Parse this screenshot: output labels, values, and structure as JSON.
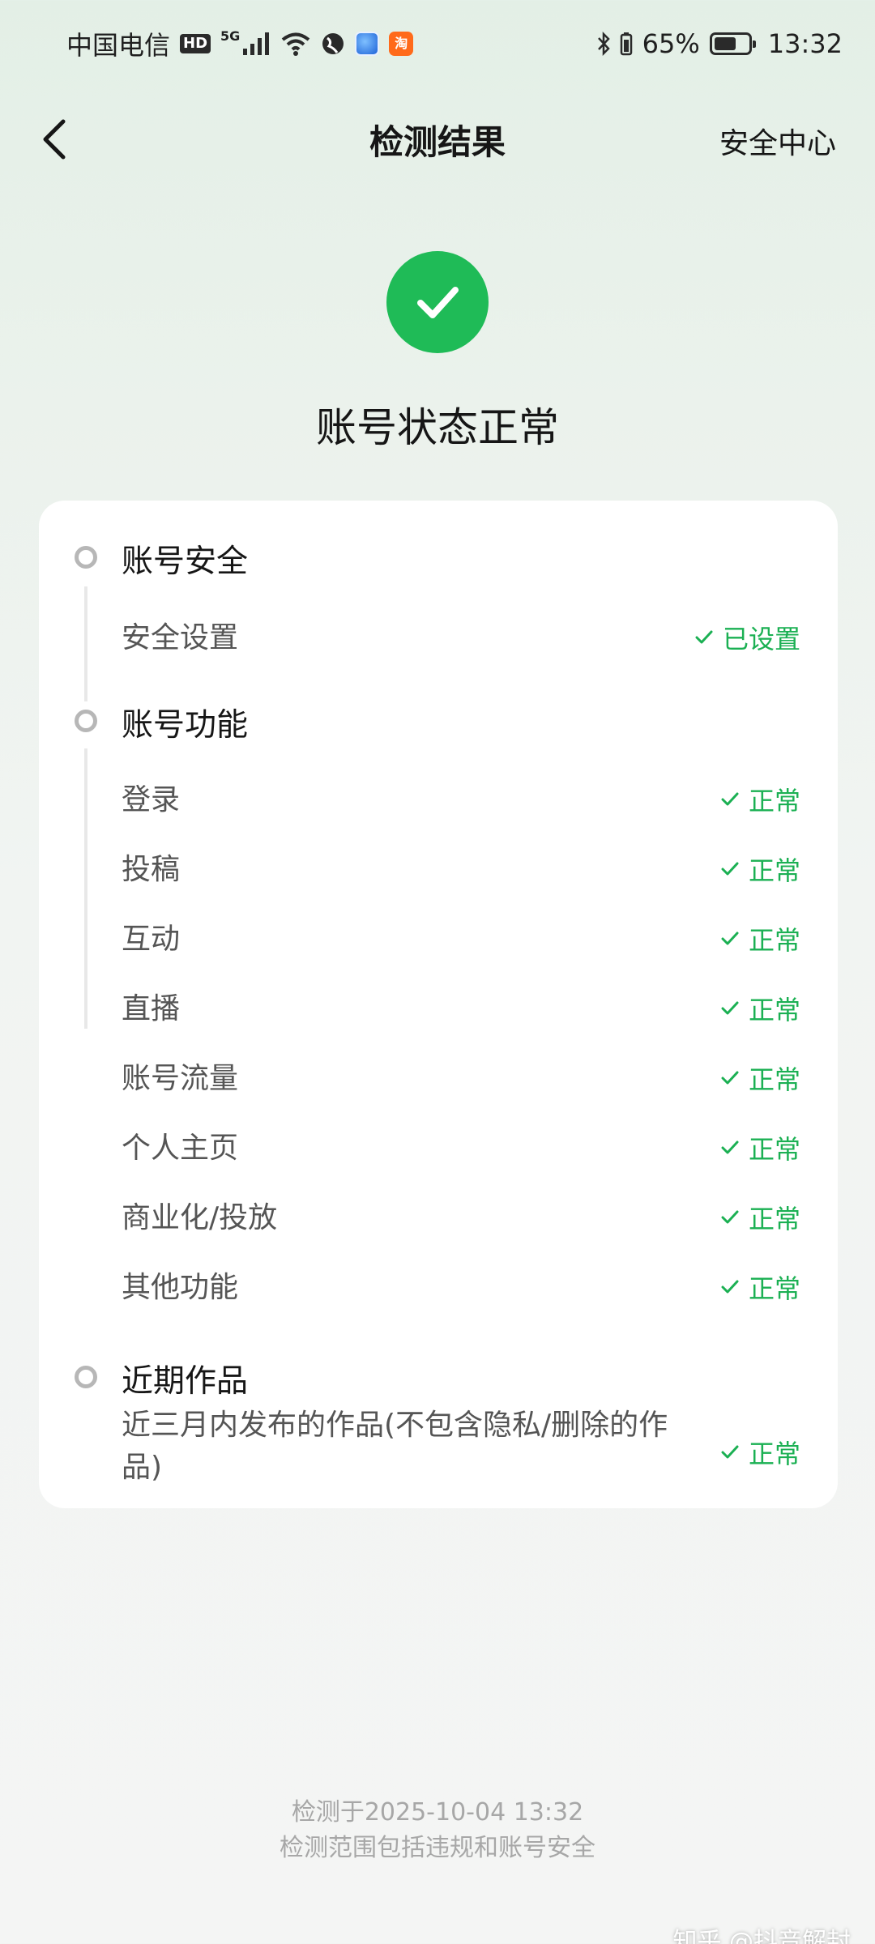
{
  "status_bar": {
    "carrier": "中国电信",
    "hd": "HD",
    "network": "5G",
    "app_chip": "淘",
    "battery": "65%",
    "battery_level": 0.65,
    "time": "13:32"
  },
  "nav": {
    "title": "检测结果",
    "right_link": "安全中心"
  },
  "hero": {
    "title": "账号状态正常",
    "accent_color": "#1fbb57"
  },
  "sections": [
    {
      "title": "账号安全",
      "items": [
        {
          "label": "安全设置",
          "status": "已设置"
        }
      ]
    },
    {
      "title": "账号功能",
      "items": [
        {
          "label": "登录",
          "status": "正常"
        },
        {
          "label": "投稿",
          "status": "正常"
        },
        {
          "label": "互动",
          "status": "正常"
        },
        {
          "label": "直播",
          "status": "正常"
        },
        {
          "label": "账号流量",
          "status": "正常"
        },
        {
          "label": "个人主页",
          "status": "正常"
        },
        {
          "label": "商业化/投放",
          "status": "正常"
        },
        {
          "label": "其他功能",
          "status": "正常"
        }
      ]
    },
    {
      "title": "近期作品",
      "items": [
        {
          "label": "近三月内发布的作品(不包含隐私/删除的作品)",
          "status": "正常"
        }
      ]
    }
  ],
  "footer": {
    "line1": "检测于2025-10-04 13:32",
    "line2": "检测范围包括违规和账号安全"
  },
  "watermark": "知乎 @抖音解封"
}
